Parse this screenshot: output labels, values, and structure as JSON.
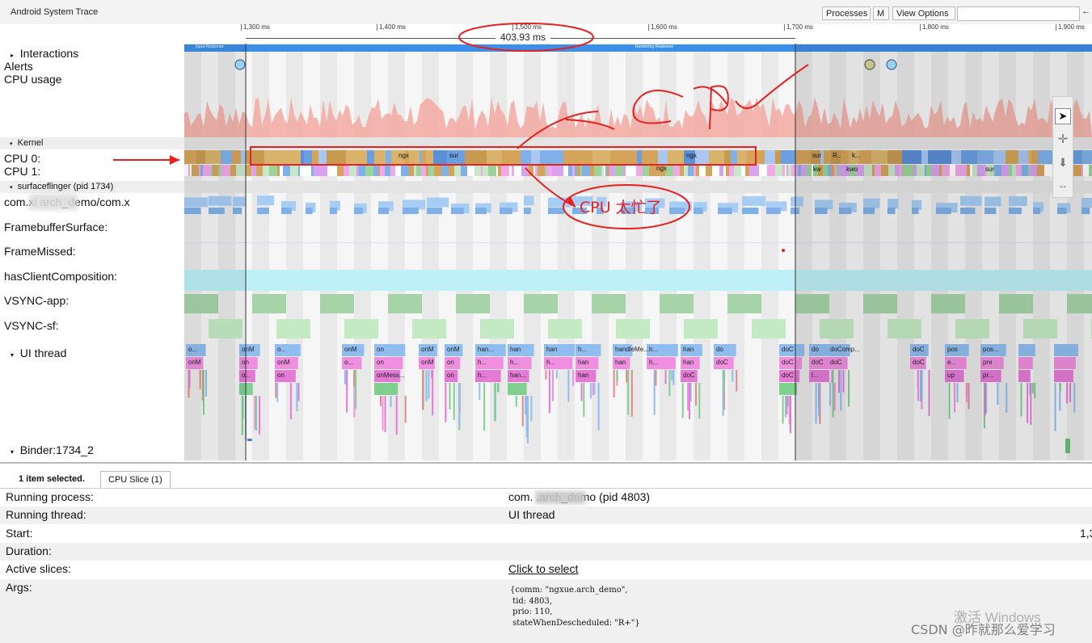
{
  "app": {
    "title": "Android System Trace"
  },
  "toolbar": {
    "processes": "Processes",
    "m": "M",
    "view_options": "View Options",
    "arrow": "←"
  },
  "ruler": {
    "labels": [
      "1,300 ms",
      "1,400 ms",
      "1,500 ms",
      "1,600 ms",
      "1,700 ms",
      "1,800 ms",
      "1,900 ms"
    ],
    "selection_duration": "403.93 ms"
  },
  "tracks": {
    "interactions": "Interactions",
    "alerts": "Alerts",
    "cpu_usage": "CPU usage",
    "kernel": "Kernel",
    "cpu0": "CPU 0:",
    "cpu1": "CPU 1:",
    "surfaceflinger": "surfaceflinger (pid 1734)",
    "com": "com.xi         arch_demo/com.x",
    "framebuffer": "FramebufferSurface:",
    "framemissed": "FrameMissed:",
    "hasclient": "hasClientComposition:",
    "vsync_app": "VSYNC-app:",
    "vsync_sf": "VSYNC-sf:",
    "ui_thread": "UI thread",
    "binder": "Binder:1734_2"
  },
  "interaction_labels": {
    "input": "Input Response",
    "rendering": "Rendering Response"
  },
  "slice_labels": {
    "cpu0": [
      "ngx",
      "sur",
      "ngx",
      "sur",
      "R..",
      "k..."
    ],
    "cpu1": [
      "ngx",
      "kw",
      "kwo",
      "sur"
    ],
    "ui": [
      "o...",
      "onM",
      "onM",
      "on",
      "o...",
      "o...",
      "onM",
      "on",
      "onM",
      "o...",
      "on",
      "on",
      "onMess...",
      "onM",
      "onM",
      "onM",
      "on",
      "on",
      "han...",
      "h...",
      "h...",
      "han",
      "h...",
      "han...",
      "han",
      "h...",
      "h...",
      "han",
      "han",
      "handleMe...",
      "han",
      "h...",
      "h...",
      "han",
      "han",
      "doC",
      "do",
      "doC",
      "doC",
      "doC",
      "doC",
      "do",
      "doC",
      "l...",
      "doComp...",
      "doC",
      "doC",
      "doC",
      "pos",
      "e...",
      "up",
      "pos...",
      "pre",
      "pr..."
    ]
  },
  "annotations": {
    "handwriting": "CPU",
    "note": "CPU 太忙了"
  },
  "bottom": {
    "selected": "1 item selected.",
    "tab": "CPU Slice (1)",
    "rows": [
      {
        "key": "Running process:",
        "value": "com.            .arch_demo (pid 4803)"
      },
      {
        "key": "Running thread:",
        "value": "UI thread"
      },
      {
        "key": "Start:",
        "value": "1,3"
      },
      {
        "key": "Duration:",
        "value": ""
      },
      {
        "key": "Active slices:",
        "value": "Click to select"
      },
      {
        "key": "Args:",
        "value": ""
      }
    ],
    "args": "{comm: \"ngxue.arch_demo\",\n tid: 4803,\n prio: 110,\n stateWhenDescheduled: \"R+\"}"
  },
  "watermark": {
    "windows": "激活 Windows",
    "csdn": "CSDN @昨就那么爱学习"
  },
  "colors": {
    "selection_blue": "#3b8fe8",
    "annotation_red": "#e82020",
    "cpu_usage": "#f2a9a0"
  }
}
